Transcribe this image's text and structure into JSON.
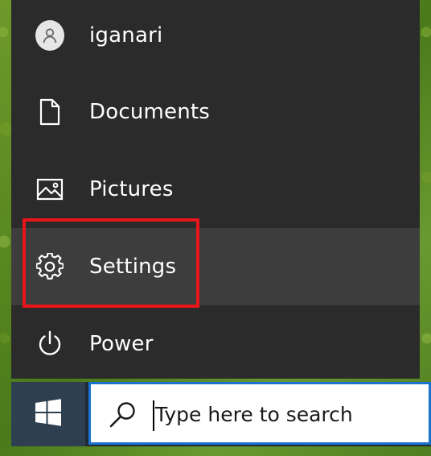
{
  "start_menu": {
    "items": [
      {
        "id": "user",
        "label": "iganari",
        "icon": "user-avatar-icon"
      },
      {
        "id": "documents",
        "label": "Documents",
        "icon": "document-icon"
      },
      {
        "id": "pictures",
        "label": "Pictures",
        "icon": "pictures-icon"
      },
      {
        "id": "settings",
        "label": "Settings",
        "icon": "gear-icon",
        "highlighted": true
      },
      {
        "id": "power",
        "label": "Power",
        "icon": "power-icon"
      }
    ]
  },
  "taskbar": {
    "start_button_icon": "windows-logo-icon",
    "search": {
      "icon": "search-icon",
      "placeholder": "Type here to search"
    }
  },
  "colors": {
    "menu_background": "#2b2b2b",
    "menu_hover": "#3d3d3d",
    "highlight_box": "#e8151a",
    "search_border": "#1a73d0",
    "taskbar": "#1f2b35",
    "start_button": "#2e4050"
  }
}
